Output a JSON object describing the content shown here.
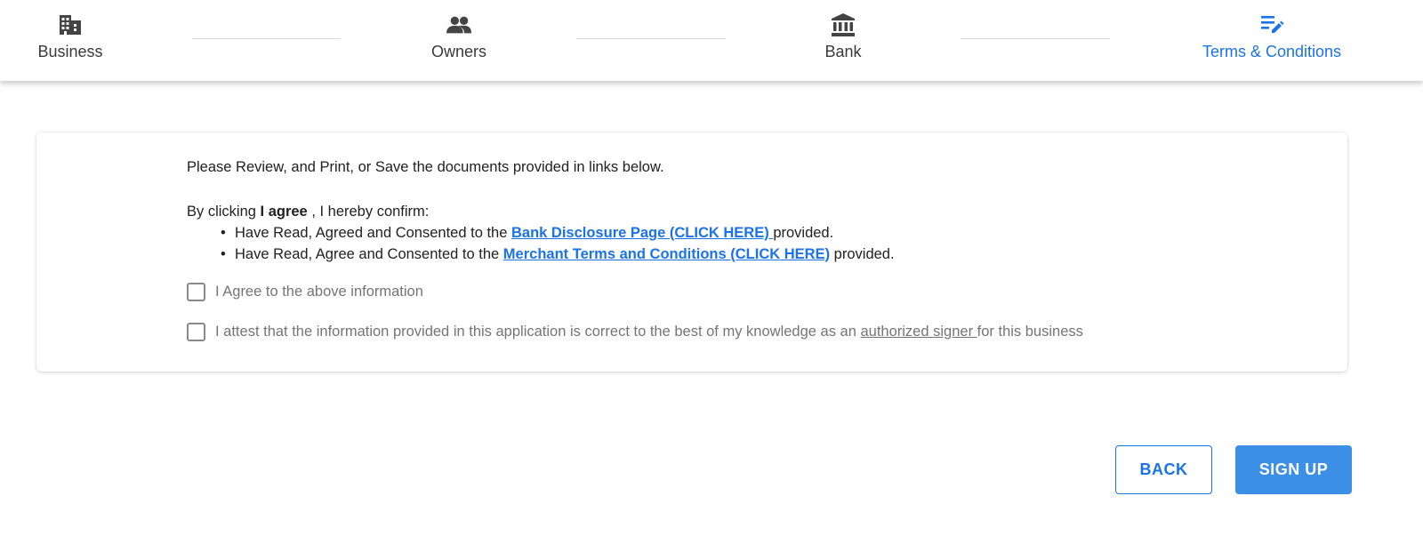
{
  "stepper": {
    "steps": [
      {
        "label": "Business",
        "icon": "building-icon",
        "active": false
      },
      {
        "label": "Owners",
        "icon": "people-icon",
        "active": false
      },
      {
        "label": "Bank",
        "icon": "bank-icon",
        "active": false
      },
      {
        "label": "Terms & Conditions",
        "icon": "edit-list-icon",
        "active": true
      }
    ]
  },
  "terms": {
    "intro": "Please Review, and Print, or Save the documents provided in links below.",
    "confirm_prefix": "By clicking ",
    "confirm_bold": "I agree",
    "confirm_suffix": " , I hereby confirm:",
    "items": [
      {
        "prefix": "Have Read, Agreed and Consented to the ",
        "link": "Bank Disclosure Page (CLICK HERE) ",
        "suffix": "provided."
      },
      {
        "prefix": "Have Read, Agree and Consented to the ",
        "link": "Merchant Terms and Conditions (CLICK HERE)",
        "suffix": " provided."
      }
    ],
    "checkbox_agree": {
      "label": "I Agree to the above information",
      "checked": false
    },
    "checkbox_attest": {
      "prefix": "I attest that the information provided in this application is correct to the best of my knowledge as an ",
      "link": "authorized signer ",
      "suffix": "for this business",
      "checked": false
    }
  },
  "actions": {
    "back_label": "BACK",
    "signup_label": "SIGN UP"
  },
  "colors": {
    "accent": "#1a73e8",
    "primary_button": "#3b8fe6",
    "muted_text": "#757575"
  }
}
